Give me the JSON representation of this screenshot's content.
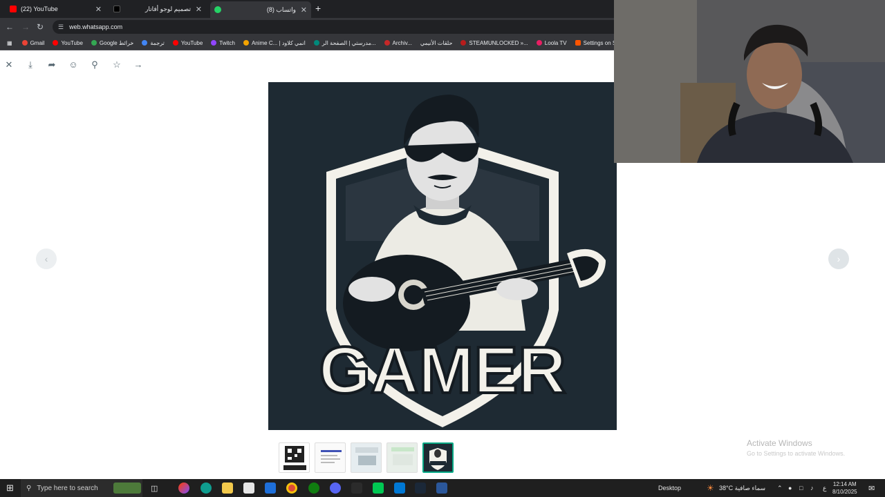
{
  "browser": {
    "tabs": [
      {
        "label": "(22) YouTube",
        "favicon_color": "#ff0000"
      },
      {
        "label": "تصميم لوجو أفاتار",
        "favicon_color": "#202124"
      },
      {
        "label": "(8) واتساب",
        "favicon_color": "#25d366"
      }
    ],
    "new_tab": "+",
    "close_glyph": "✕",
    "url": "web.whatsapp.com",
    "bookmarks": [
      {
        "label": "Gmail",
        "color": "#ea4335"
      },
      {
        "label": "YouTube",
        "color": "#ff0000"
      },
      {
        "label": "Google خرائط",
        "color": "#34a853"
      },
      {
        "label": "ترجمة",
        "color": "#4285f4"
      },
      {
        "label": "YouTube",
        "color": "#ff0000"
      },
      {
        "label": "Twitch",
        "color": "#9146ff"
      },
      {
        "label": "Anime C... | انمي كلاود",
        "color": "#f4a300"
      },
      {
        "label": "مدرستي | الصفحة الر...",
        "color": "#00897b"
      },
      {
        "label": "Archiv...",
        "color": "#c62828"
      },
      {
        "label": "حلقات الأنيمي",
        "color": "#c62828"
      },
      {
        "label": "STEAMUNLOCKED »...",
        "color": "#b71c1c"
      },
      {
        "label": "Loola TV",
        "color": "#e91e63"
      },
      {
        "label": "Settings on SoundC...",
        "color": "#ff5500"
      }
    ]
  },
  "viewer": {
    "toolbar_icons": [
      "close-icon",
      "download-icon",
      "forward-icon",
      "emoji-icon",
      "pin-icon",
      "star-icon",
      "go-to-message-icon"
    ],
    "image_alt": "GAMER",
    "image_text": "GAMER",
    "prev_glyph": "‹",
    "next_glyph": "›",
    "thumbnails": 5,
    "selected_thumbnail": 5
  },
  "watermark": {
    "line1": "Activate Windows",
    "line2": "Go to Settings to activate Windows."
  },
  "taskbar": {
    "search_placeholder": "Type here to search",
    "desktop_label": "Desktop",
    "weather": "38°C سماء صافية",
    "time": "12:14 AM",
    "date": "8/10/2025",
    "lang": "ع"
  },
  "colors": {
    "accent": "#00a884",
    "chrome_dark": "#202124",
    "chrome_mid": "#35363a"
  }
}
